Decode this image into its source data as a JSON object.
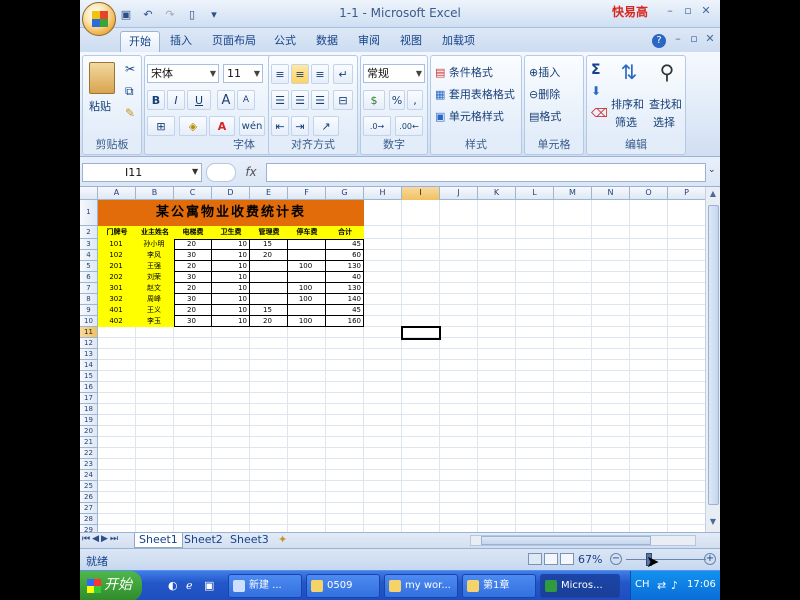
{
  "app": {
    "window_title": "1-1 - Microsoft Excel",
    "brand": "快易高"
  },
  "qat": {
    "icons": [
      "save-icon",
      "undo-icon",
      "redo-icon",
      "new-icon",
      "customize-icon"
    ]
  },
  "window_controls": [
    "minimize-icon",
    "restore-icon",
    "close-icon"
  ],
  "tabs": [
    "开始",
    "插入",
    "页面布局",
    "公式",
    "数据",
    "审阅",
    "视图",
    "加载项"
  ],
  "ribbon": {
    "clipboard": {
      "label": "剪贴板",
      "paste": "粘贴"
    },
    "font": {
      "label": "字体",
      "name": "宋体",
      "size": "11",
      "bold": "B",
      "italic": "I",
      "underline": "U",
      "grow": "A",
      "shrink": "A",
      "phonetic": "wén"
    },
    "alignment": {
      "label": "对齐方式"
    },
    "number": {
      "label": "数字",
      "format": "常规",
      "percent": "%",
      "comma": ","
    },
    "styles": {
      "label": "样式",
      "cond": "条件格式",
      "table": "套用表格格式",
      "cell": "单元格样式"
    },
    "cells": {
      "label": "单元格",
      "insert": "插入",
      "delete": "删除",
      "format": "格式"
    },
    "editing": {
      "label": "编辑",
      "sigma": "Σ",
      "sort": "排序和",
      "sort2": "筛选",
      "find": "查找和",
      "find2": "选择"
    }
  },
  "formula_bar": {
    "namebox": "I11",
    "fx": "fx",
    "value": ""
  },
  "columns": [
    "A",
    "B",
    "C",
    "D",
    "E",
    "F",
    "G",
    "H",
    "I",
    "J",
    "K",
    "L",
    "M",
    "N",
    "O",
    "P"
  ],
  "selected_column": "I",
  "rows": [
    "1",
    "2",
    "3",
    "4",
    "5",
    "6",
    "7",
    "8",
    "9",
    "10",
    "11",
    "12",
    "13",
    "14",
    "15",
    "16",
    "17",
    "18",
    "19",
    "20",
    "21",
    "22",
    "23",
    "24",
    "25",
    "26",
    "27",
    "28",
    "29"
  ],
  "selected_row": "11",
  "table": {
    "title": "某公寓物业收费统计表",
    "headers": [
      "门牌号",
      "业主姓名",
      "电梯费",
      "卫生费",
      "管理费",
      "停车费",
      "合计"
    ],
    "rows": [
      [
        "101",
        "孙小明",
        "20",
        "10",
        "15",
        "",
        "45"
      ],
      [
        "102",
        "李风",
        "30",
        "10",
        "20",
        "",
        "60"
      ],
      [
        "201",
        "王强",
        "20",
        "10",
        "",
        "100",
        "130"
      ],
      [
        "202",
        "刘荣",
        "30",
        "10",
        "",
        "",
        "40"
      ],
      [
        "301",
        "赵文",
        "20",
        "10",
        "",
        "100",
        "130"
      ],
      [
        "302",
        "周峰",
        "30",
        "10",
        "",
        "100",
        "140"
      ],
      [
        "401",
        "王义",
        "20",
        "10",
        "15",
        "",
        "45"
      ],
      [
        "402",
        "李玉",
        "30",
        "10",
        "20",
        "100",
        "160"
      ]
    ]
  },
  "sheets": [
    "Sheet1",
    "Sheet2",
    "Sheet3"
  ],
  "status": {
    "ready": "就绪",
    "zoom": "67%"
  },
  "taskbar": {
    "start": "开始",
    "tasks": [
      "新建 ...",
      "0509",
      "my wor...",
      "第1章",
      "Micros..."
    ],
    "ime": "CH",
    "clock": "17:06"
  },
  "colors": {
    "title_fill": "#e26b0a",
    "header_fill": "#ffff00",
    "accent": "#15428b"
  }
}
